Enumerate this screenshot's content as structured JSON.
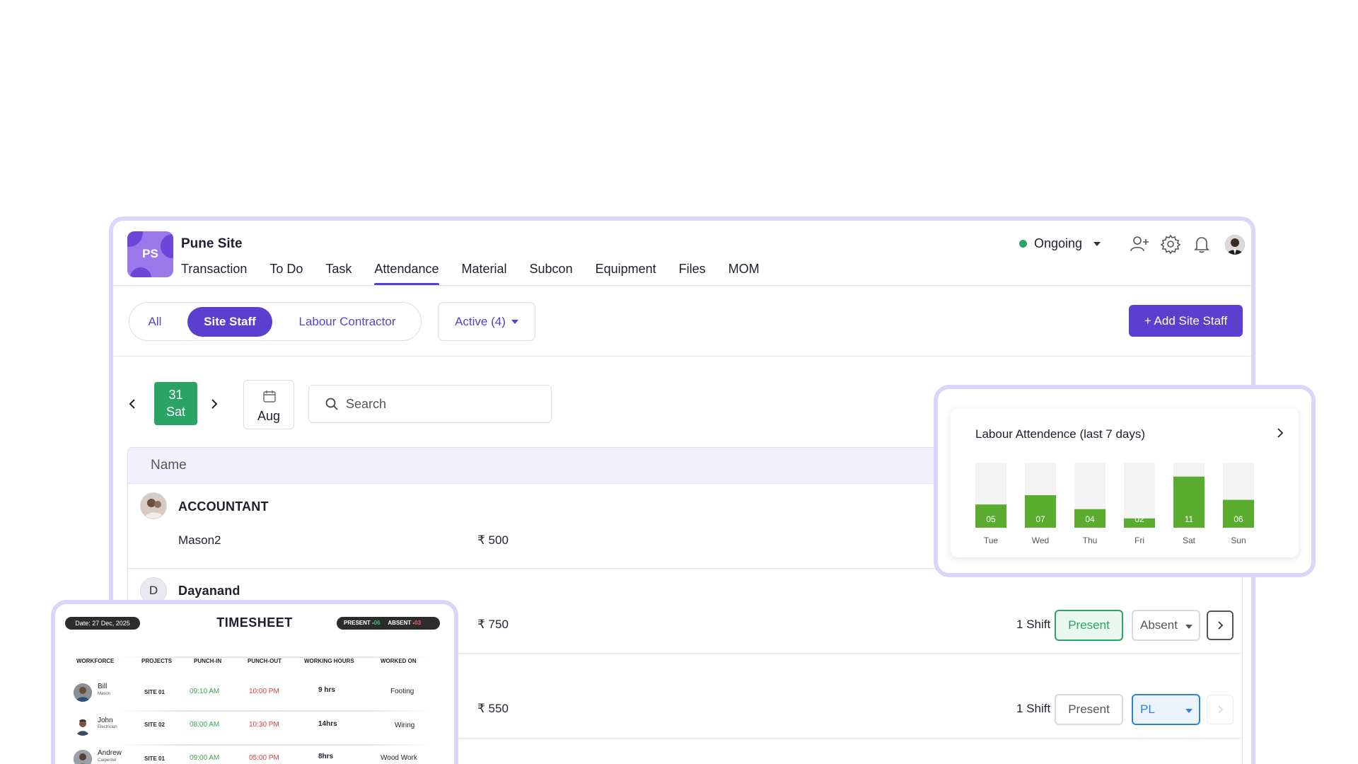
{
  "header": {
    "logo_text": "PS",
    "site_title": "Pune Site",
    "tabs": [
      "Transaction",
      "To Do",
      "Task",
      "Attendance",
      "Material",
      "Subcon",
      "Equipment",
      "Files",
      "MOM"
    ],
    "status": "Ongoing",
    "status_color": "#2aa464"
  },
  "filters": {
    "segments": [
      "All",
      "Site Staff",
      "Labour Contractor"
    ],
    "active_segment": "Site Staff",
    "status_filter": "Active (4)",
    "add_button": "+ Add Site Staff"
  },
  "date_nav": {
    "day": "31",
    "weekday": "Sat",
    "month": "Aug",
    "search_placeholder": "Search"
  },
  "table": {
    "column_name": "Name",
    "groups": [
      {
        "title": "ACCOUNTANT",
        "rows": [
          {
            "member": "Mason2",
            "amount": "₹ 500"
          }
        ]
      },
      {
        "title": "Dayanand",
        "initial": "D",
        "rows": [
          {
            "member": "",
            "amount": "₹ 750",
            "shift": "1 Shift",
            "present": "Present",
            "status": "Absent"
          },
          {
            "member": "",
            "amount": "₹ 550",
            "shift": "1 Shift",
            "present": "Present",
            "status": "PL"
          }
        ]
      }
    ]
  },
  "chart_data": {
    "type": "bar",
    "title": "Labour Attendence (last 7 days)",
    "categories": [
      "Tue",
      "Wed",
      "Thu",
      "Fri",
      "Sat",
      "Sun"
    ],
    "values": [
      5,
      7,
      4,
      2,
      11,
      6
    ],
    "value_labels": [
      "05",
      "07",
      "04",
      "02",
      "11",
      "06"
    ],
    "ylim": [
      0,
      14
    ],
    "bar_color": "#5aac2e",
    "track_color": "#f3f3f3"
  },
  "timesheet": {
    "date": "Date: 27 Dec, 2025",
    "title": "TIMESHEET",
    "present_label": "PRESENT -",
    "present_count": "06",
    "absent_label": "ABSENT -",
    "absent_count": "03",
    "columns": [
      "WORKFORCE",
      "PROJECTS",
      "PUNCH-IN",
      "PUNCH-OUT",
      "WORKING HOURS",
      "WORKED ON"
    ],
    "rows": [
      {
        "name": "Bill",
        "role": "Mason",
        "project": "SITE 01",
        "in": "09:10 AM",
        "out": "10:00 PM",
        "hours": "9 hrs",
        "work": "Footing"
      },
      {
        "name": "John",
        "role": "Electrician",
        "project": "SITE 02",
        "in": "08:00 AM",
        "out": "10:30 PM",
        "hours": "14hrs",
        "work": "Wiring"
      },
      {
        "name": "Andrew",
        "role": "Carpenter",
        "project": "SITE 01",
        "in": "09:00 AM",
        "out": "05:00 PM",
        "hours": "8hrs",
        "work": "Wood Work"
      }
    ]
  }
}
